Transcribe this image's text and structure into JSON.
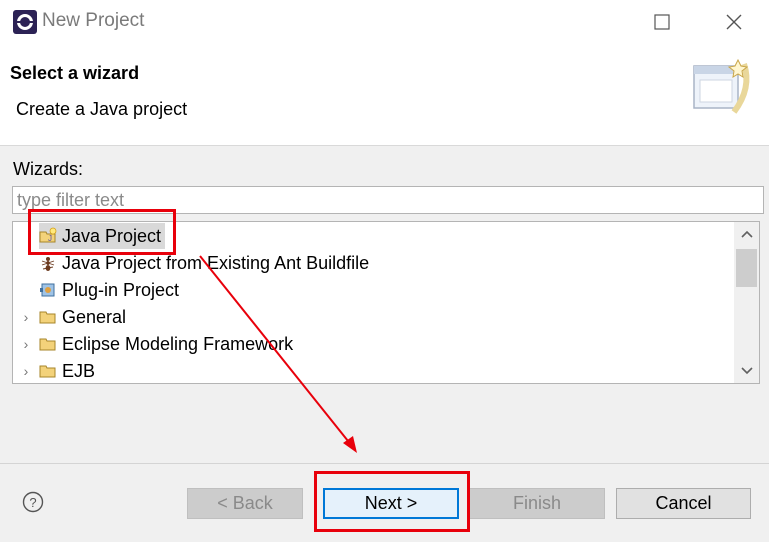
{
  "window": {
    "title": "New Project",
    "icons": [
      "eclipse-app-icon",
      "maximize-icon",
      "close-icon"
    ]
  },
  "header": {
    "title": "Select a wizard",
    "description": "Create a Java project",
    "banner_icon": "wizard-banner-icon"
  },
  "wizards": {
    "label": "Wizards:",
    "filter_placeholder": "type filter text",
    "items": [
      {
        "label": "Java Project",
        "icon": "java-project-icon",
        "expandable": false,
        "selected": true
      },
      {
        "label": "Java Project from Existing Ant Buildfile",
        "icon": "ant-icon",
        "expandable": false,
        "selected": false
      },
      {
        "label": "Plug-in Project",
        "icon": "plugin-icon",
        "expandable": false,
        "selected": false
      },
      {
        "label": "General",
        "icon": "folder-icon",
        "expandable": true,
        "selected": false
      },
      {
        "label": "Eclipse Modeling Framework",
        "icon": "folder-icon",
        "expandable": true,
        "selected": false
      },
      {
        "label": "EJB",
        "icon": "folder-icon",
        "expandable": true,
        "selected": false
      }
    ]
  },
  "buttons": {
    "back": "< Back",
    "next": "Next >",
    "finish": "Finish",
    "cancel": "Cancel",
    "help_icon": "help-icon"
  },
  "colors": {
    "annotation": "#e8000b",
    "default_button_border": "#0078d7",
    "selection": "#d9d9d9"
  }
}
